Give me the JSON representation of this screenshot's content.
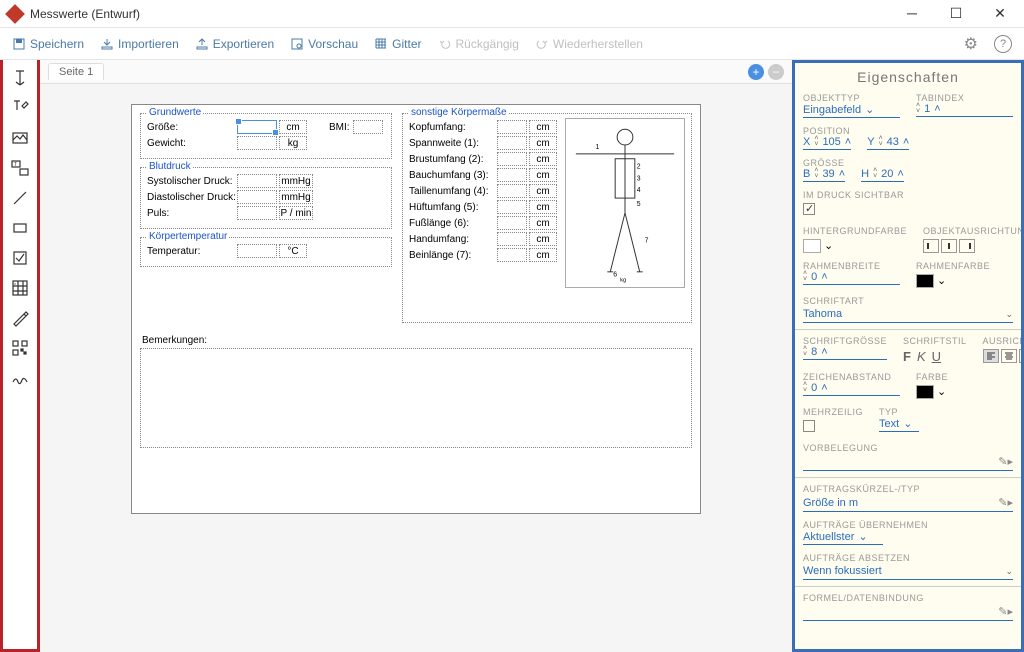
{
  "window": {
    "title": "Messwerte (Entwurf)"
  },
  "toolbar": {
    "save": "Speichern",
    "import": "Importieren",
    "export": "Exportieren",
    "preview": "Vorschau",
    "grid": "Gitter",
    "undo": "Rückgängig",
    "redo": "Wiederherstellen"
  },
  "tabs": {
    "page1": "Seite 1"
  },
  "form": {
    "grundwerte": {
      "legend": "Grundwerte",
      "groesse_label": "Größe:",
      "groesse_unit": "cm",
      "gewicht_label": "Gewicht:",
      "gewicht_unit": "kg",
      "bmi_label": "BMI:"
    },
    "blutdruck": {
      "legend": "Blutdruck",
      "sys_label": "Systolischer Druck:",
      "sys_unit": "mmHg",
      "dia_label": "Diastolischer Druck:",
      "dia_unit": "mmHg",
      "puls_label": "Puls:",
      "puls_unit": "P / min"
    },
    "temperatur": {
      "legend": "Körpertemperatur",
      "temp_label": "Temperatur:",
      "temp_unit": "°C"
    },
    "koerpermasse": {
      "legend": "sonstige Körpermaße",
      "kopf": "Kopfumfang:",
      "spann": "Spannweite (1):",
      "brust": "Brustumfang (2):",
      "bauch": "Bauchumfang (3):",
      "taille": "Taillenumfang (4):",
      "hueft": "Hüftumfang (5):",
      "fuss": "Fußlänge (6):",
      "hand": "Handumfang:",
      "bein": "Beinlänge (7):",
      "unit": "cm"
    },
    "bemerkungen": "Bemerkungen:"
  },
  "props": {
    "title": "Eigenschaften",
    "objekttyp_label": "OBJEKTTYP",
    "objekttyp_val": "Eingabefeld",
    "tabindex_label": "TABINDEX",
    "tabindex_val": "1",
    "position_label": "POSITION",
    "x_label": "X",
    "x_val": "105",
    "y_label": "Y",
    "y_val": "43",
    "groesse_label": "GRÖSSE",
    "b_label": "B",
    "b_val": "39",
    "h_label": "H",
    "h_val": "20",
    "druck_label": "IM DRUCK SICHTBAR",
    "hintergrund_label": "HINTERGRUNDFARBE",
    "ausrichtung_label": "OBJEKTAUSRICHTUNG",
    "rahmenbreite_label": "RAHMENBREITE",
    "rahmenbreite_val": "0",
    "rahmenfarbe_label": "RAHMENFARBE",
    "schriftart_label": "SCHRIFTART",
    "schriftart_val": "Tahoma",
    "schriftgroesse_label": "SCHRIFTGRÖSSE",
    "schriftgroesse_val": "8",
    "schriftstil_label": "SCHRIFTSTIL",
    "ausrichtung2_label": "AUSRICHTUNG",
    "zeichenabstand_label": "ZEICHENABSTAND",
    "zeichenabstand_val": "0",
    "farbe_label": "FARBE",
    "mehrzeilig_label": "MEHRZEILIG",
    "typ_label": "TYP",
    "typ_val": "Text",
    "vorbelegung_label": "VORBELEGUNG",
    "auftragskuerzel_label": "AUFTRAGSKÜRZEL-/TYP",
    "auftragskuerzel_val": "Größe in m",
    "auftraege_uebernehmen_label": "AUFTRÄGE ÜBERNEHMEN",
    "auftraege_uebernehmen_val": "Aktuellster",
    "auftraege_absetzen_label": "AUFTRÄGE ABSETZEN",
    "auftraege_absetzen_val": "Wenn fokussiert",
    "formel_label": "FORMEL/DATENBINDUNG",
    "colors": {
      "black": "#000000",
      "white": "#ffffff"
    }
  }
}
